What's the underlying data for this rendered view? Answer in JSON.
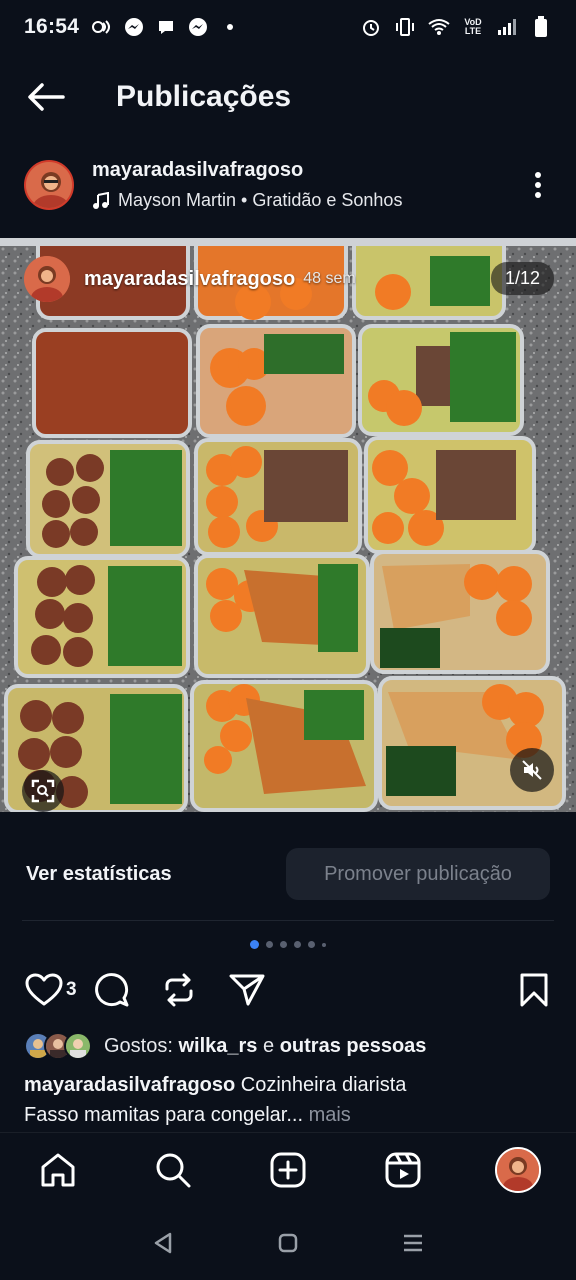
{
  "status_bar": {
    "time": "16:54",
    "left_icons": [
      "voicemail-icon",
      "messenger-icon",
      "chat-bubble-icon",
      "messenger-icon",
      "dot-icon"
    ],
    "right_icons": [
      "alarm-icon",
      "vibrate-icon",
      "wifi-icon",
      "volte-icon",
      "signal-icon",
      "signal-icon",
      "battery-icon"
    ],
    "volte_label_top": "VoD",
    "volte_label_bottom": "LTE"
  },
  "header": {
    "title": "Publicações"
  },
  "post": {
    "username": "mayaradasilvafragoso",
    "music": "Mayson Martin • Gratidão e Sonhos",
    "overlay_username": "mayaradasilvafragoso",
    "overlay_time": "48 sem",
    "counter": "1/12"
  },
  "stats": {
    "view_label": "Ver estatísticas",
    "promote_label": "Promover publicação"
  },
  "carousel": {
    "total": 12,
    "current": 1
  },
  "actions": {
    "like_count": "3"
  },
  "likes": {
    "prefix": "Gostos:",
    "user": "wilka_rs",
    "connector": "e",
    "others": "outras pessoas"
  },
  "caption": {
    "username": "mayaradasilvafragoso",
    "line1": "Cozinheira diarista",
    "line2": "Fasso mamitas para congelar",
    "ellipsis": "...",
    "more": "mais"
  },
  "bottom_nav": {
    "items": [
      "home-icon",
      "search-icon",
      "create-icon",
      "reels-icon",
      "profile-avatar"
    ]
  },
  "system_nav": {
    "items": [
      "back-icon",
      "home-icon",
      "recents-icon"
    ]
  },
  "colors": {
    "background": "#0b101a",
    "accent": "#3b82f6",
    "button_bg": "#1c222d",
    "muted": "#7b818c"
  }
}
